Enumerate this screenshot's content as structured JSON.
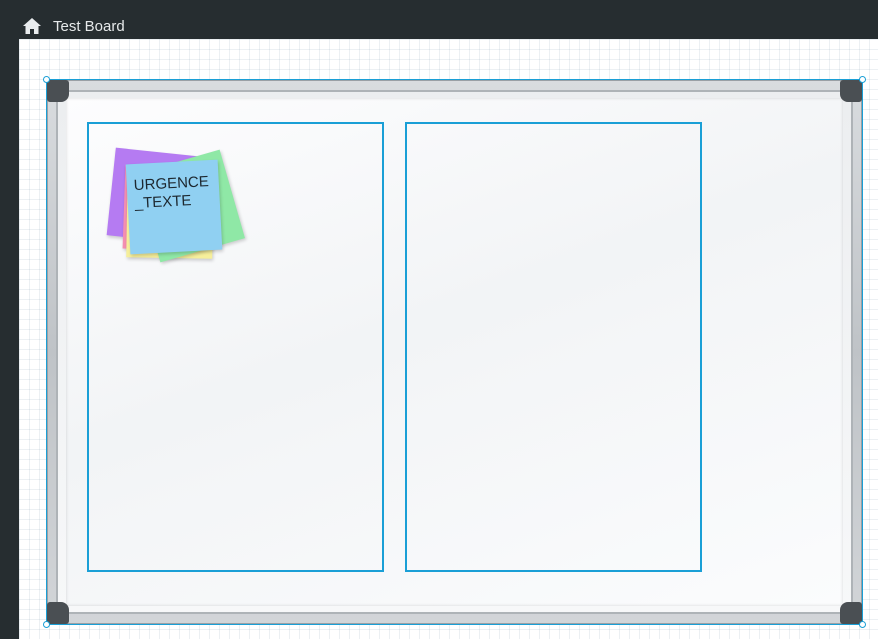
{
  "header": {
    "home_icon": "home-icon",
    "board_title": "Test Board"
  },
  "board": {
    "frame_color": "#c5c9cd",
    "selection_color": "#1a9fd6",
    "columns": [
      {
        "name": "column-1",
        "border_color": "#1a9fd6"
      },
      {
        "name": "column-2",
        "border_color": "#1a9fd6"
      }
    ],
    "sticky_stack": {
      "colors": [
        "#b57bf2",
        "#f48fb1",
        "#f6ef9b",
        "#8fe8a6",
        "#90d0f2"
      ],
      "top_note_text": "URGENCE\n_TEXTE"
    }
  }
}
